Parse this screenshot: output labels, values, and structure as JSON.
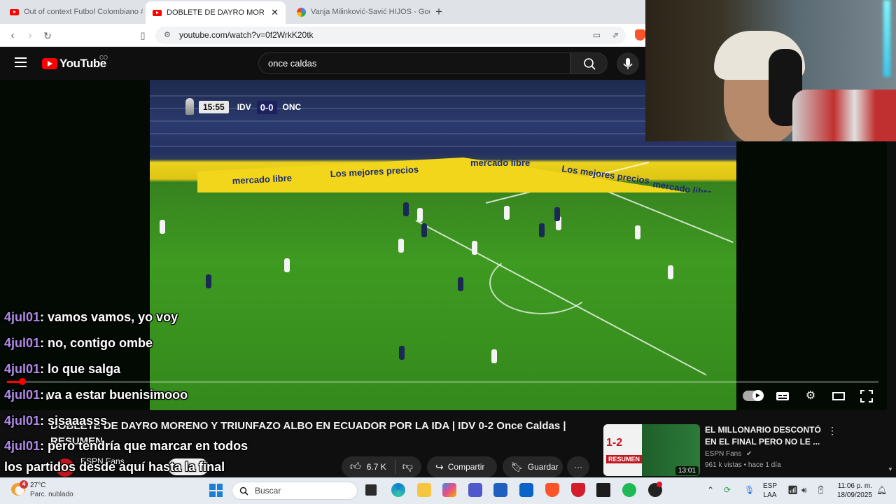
{
  "browser": {
    "tabs": [
      {
        "title": "Out of context Futbol Colombiano #...",
        "favicon": "youtube-icon",
        "active": false
      },
      {
        "title": "DOBLETE DE DAYRO MORENO Y...",
        "favicon": "youtube-icon",
        "active": true
      },
      {
        "title": "Vanja Milinković-Savić HIJOS - Goog...",
        "favicon": "google-icon",
        "active": false
      }
    ],
    "new_tab": "+",
    "close_tab": "✕",
    "url": "youtube.com/watch?v=0f2WrkK20tk"
  },
  "youtube": {
    "logo_text": "YouTube",
    "region": "CO",
    "search_value": "once caldas"
  },
  "player": {
    "scorebug": {
      "time": "15:55",
      "home": "IDV",
      "score": "0-0",
      "away": "ONC"
    },
    "ad_text": "mercado libre",
    "ad_text_2": "Los mejores precios",
    "progress_fraction": 0.018
  },
  "video": {
    "title": "DOBLETE DE DAYRO MORENO Y TRIUNFAZO ALBO EN ECUADOR POR LA IDA | IDV 0-2 Once Caldas | RESUMEN",
    "channel": "ESPN Fans",
    "likes": "6.7 K",
    "share_label": "Compartir",
    "save_label": "Guardar",
    "more_label": "···"
  },
  "related": {
    "title": "EL MILLONARIO DESCONTÓ EN EL FINAL PERO NO LE ...",
    "channel": "ESPN Fans",
    "meta": "961 k vistas • hace 1 día",
    "duration": "13:01",
    "thumb_score": "1-2",
    "thumb_label": "RESUMEN"
  },
  "chat": [
    {
      "user": "4jul01",
      "message": ": vamos vamos, yo voy"
    },
    {
      "user": "4jul01",
      "message": ": no, contigo ombe"
    },
    {
      "user": "4jul01",
      "message": ": lo que salga"
    },
    {
      "user": "4jul01",
      "message": ": va a estar buenisimooo"
    },
    {
      "user": "4jul01",
      "message": ": sisaaasss"
    },
    {
      "user": "4jul01",
      "message": ": pero tendría que marcar en todos"
    }
  ],
  "chat_continuation": "los partidos desde aquí hasta la final",
  "taskbar": {
    "weather_badge": "4",
    "temperature": "27°C",
    "weather": "Parc. nublado",
    "search_placeholder": "Buscar",
    "lang_1": "ESP",
    "lang_2": "LAA",
    "time": "11:06 p. m.",
    "date": "18/09/2025"
  }
}
